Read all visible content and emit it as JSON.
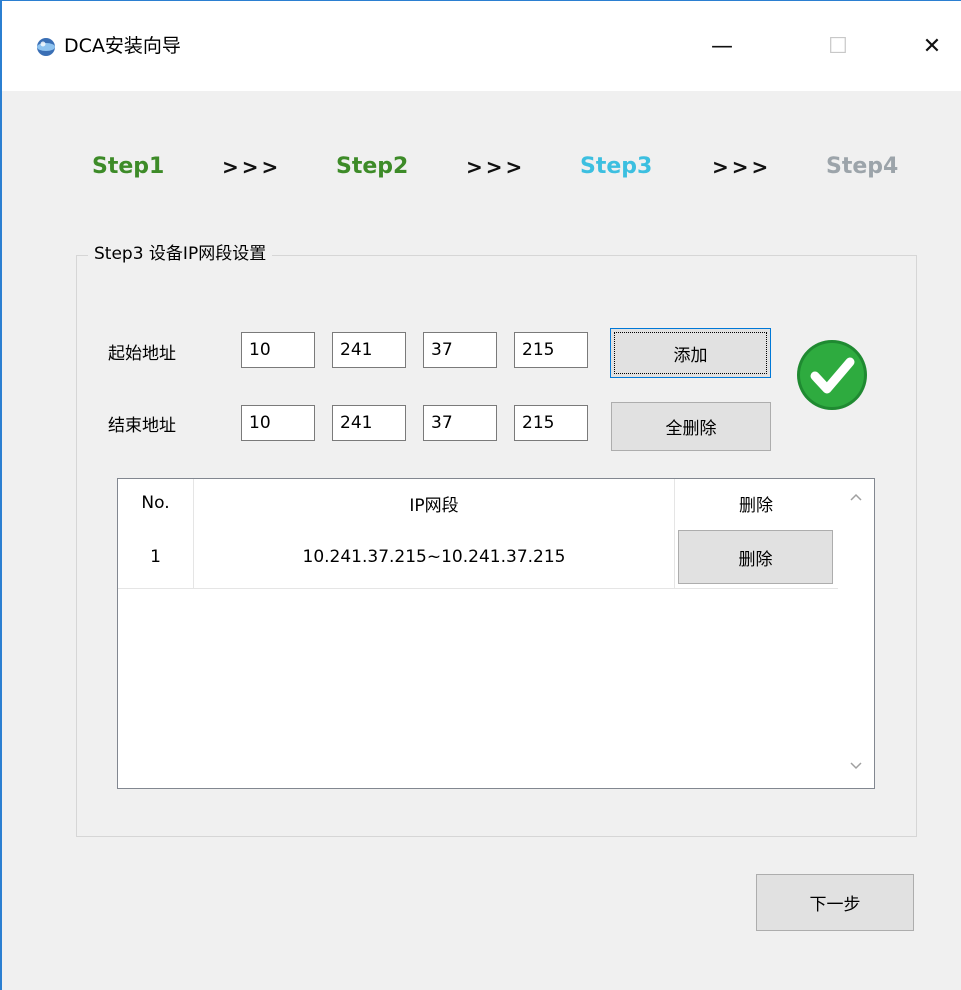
{
  "window": {
    "title": "DCA安装向导",
    "minimize_glyph": "—",
    "maximize_glyph": "☐",
    "close_glyph": "✕",
    "icon": "app-globe-icon"
  },
  "steps": [
    {
      "label": "Step1",
      "state": "done"
    },
    {
      "label": "Step2",
      "state": "done"
    },
    {
      "label": "Step3",
      "state": "current"
    },
    {
      "label": "Step4",
      "state": "todo"
    }
  ],
  "step_separator": ">>>",
  "colors": {
    "done": "#3d8b28",
    "current": "#3cbfe0",
    "todo": "#9ca4aa",
    "success": "#2eab3f",
    "frame": "#2b7fd1"
  },
  "group": {
    "legend": "Step3 设备IP网段设置",
    "start_label": "起始地址",
    "end_label": "结束地址",
    "start_ip": [
      "10",
      "241",
      "37",
      "215"
    ],
    "end_ip": [
      "10",
      "241",
      "37",
      "215"
    ],
    "add_button": "添加",
    "delete_all_button": "全删除",
    "status_icon": "success-check-icon"
  },
  "table": {
    "headers": [
      "No.",
      "IP网段",
      "删除"
    ],
    "rows": [
      {
        "no": "1",
        "range": "10.241.37.215~10.241.37.215",
        "action": "删除"
      }
    ]
  },
  "next_button": "下一步"
}
